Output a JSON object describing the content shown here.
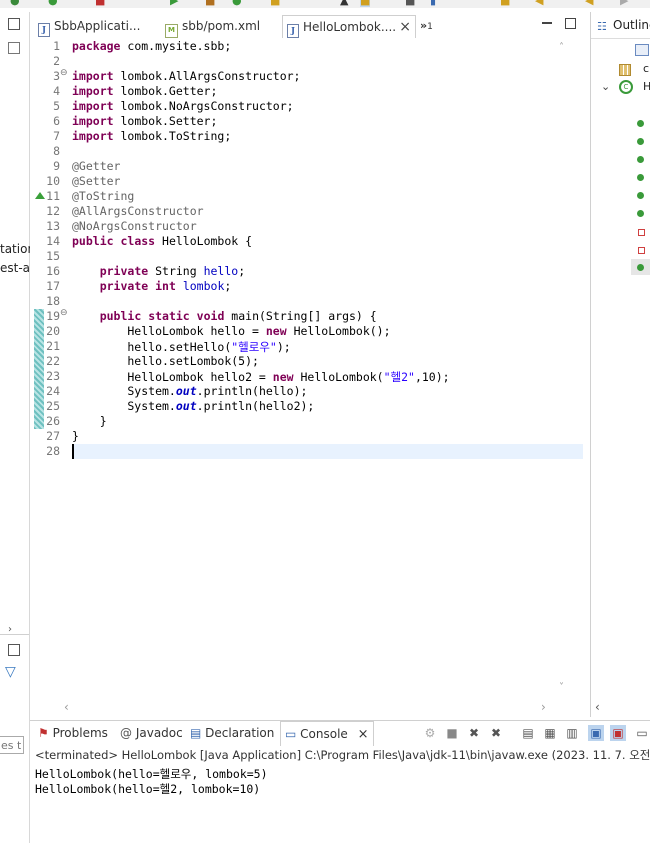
{
  "window": {
    "title": "Eclipse Java Editor"
  },
  "editor_tabs": [
    {
      "label": "SbbApplicati...",
      "icon": "java-file-icon"
    },
    {
      "label": "sbb/pom.xml",
      "icon": "maven-file-icon"
    },
    {
      "label": "HelloLombok....",
      "icon": "java-file-icon",
      "active": true
    }
  ],
  "overflow_tab": {
    "count": "1"
  },
  "left_pane": {
    "texts": [
      "tation",
      "est-a"
    ],
    "filter_placeholder": "es to"
  },
  "outline": {
    "title": "Outline",
    "items": [
      "c",
      "H"
    ]
  },
  "code_lines": [
    "package com.mysite.sbb;",
    "",
    "import lombok.AllArgsConstructor;",
    "import lombok.Getter;",
    "import lombok.NoArgsConstructor;",
    "import lombok.Setter;",
    "import lombok.ToString;",
    "",
    "@Getter",
    "@Setter",
    "@ToString",
    "@AllArgsConstructor",
    "@NoArgsConstructor",
    "public class HelloLombok {",
    "",
    "    private String hello;",
    "    private int lombok;",
    "",
    "    public static void main(String[] args) {",
    "        HelloLombok hello = new HelloLombok();",
    "        hello.setHello(\"헬로우\");",
    "        hello.setLombok(5);",
    "        HelloLombok hello2 = new HelloLombok(\"헬2\",10);",
    "        System.out.println(hello);",
    "        System.out.println(hello2);",
    "    }",
    "}",
    ""
  ],
  "console": {
    "tabs": [
      {
        "label": "Problems",
        "icon": "problems-icon"
      },
      {
        "label": "Javadoc",
        "icon": "javadoc-icon"
      },
      {
        "label": "Declaration",
        "icon": "declaration-icon"
      },
      {
        "label": "Console",
        "icon": "console-icon",
        "active": true
      }
    ],
    "status": "<terminated> HelloLombok [Java Application] C:\\Program Files\\Java\\jdk-11\\bin\\javaw.exe  (2023. 11. 7. 오전",
    "output": [
      "HelloLombok(hello=헬로우, lombok=5)",
      "HelloLombok(hello=헬2, lombok=10)"
    ]
  },
  "colors": {
    "keyword": "#7f0055",
    "annotation": "#646464",
    "string": "#2a00ff",
    "field": "#0000c0",
    "current_line": "#e8f2fe"
  }
}
